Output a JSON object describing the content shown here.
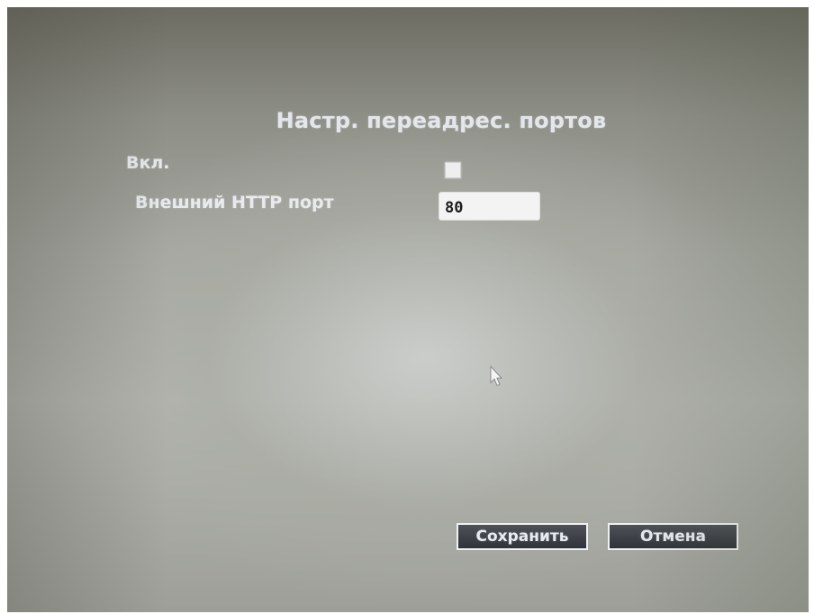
{
  "dialog": {
    "title": "Настр. переадрес. портов"
  },
  "form": {
    "enable_label": "Вкл.",
    "enable_checked": false,
    "http_port_label": "Внешний HTTP порт",
    "http_port_value": "80"
  },
  "actions": {
    "save_label": "Сохранить",
    "cancel_label": "Отмена"
  },
  "icons": {
    "cursor": "mouse-pointer-icon"
  }
}
